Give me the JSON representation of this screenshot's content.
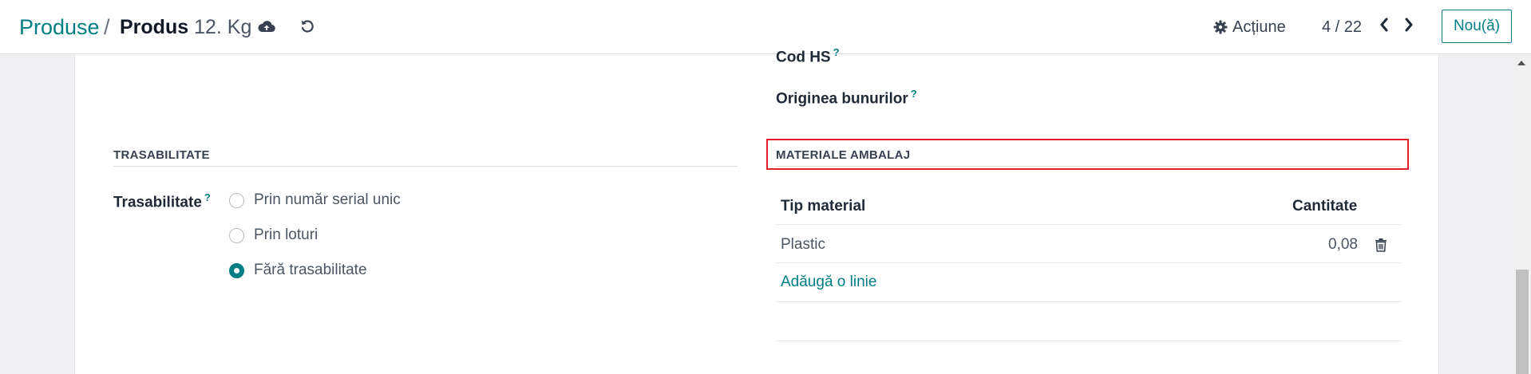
{
  "breadcrumb": {
    "parent": "Produse",
    "separator": "/",
    "current_bold": "Produs",
    "current_rest": "12. Kg"
  },
  "toolbar": {
    "save_icon": "cloud-upload-icon",
    "discard_icon": "undo-icon",
    "action_label": "Acțiune",
    "action_icon": "gear-icon",
    "pager": "4 / 22",
    "new_label": "Nou(ă)"
  },
  "fields": {
    "cod_hs_label": "Cod HS",
    "origin_label": "Originea bunurilor",
    "help_mark": "?"
  },
  "traceability": {
    "section_title": "TRASABILITATE",
    "field_label": "Trasabilitate",
    "options": [
      {
        "label": "Prin număr serial unic",
        "checked": false
      },
      {
        "label": "Prin loturi",
        "checked": false
      },
      {
        "label": "Fără trasabilitate",
        "checked": true
      }
    ]
  },
  "packaging": {
    "section_title": "MATERIALE AMBALAJ",
    "columns": [
      "Tip material",
      "Cantitate"
    ],
    "rows": [
      {
        "material": "Plastic",
        "quantity": "0,08"
      }
    ],
    "add_line": "Adăugă o linie"
  },
  "colors": {
    "accent": "#017e84",
    "highlight": "#e11d26"
  }
}
